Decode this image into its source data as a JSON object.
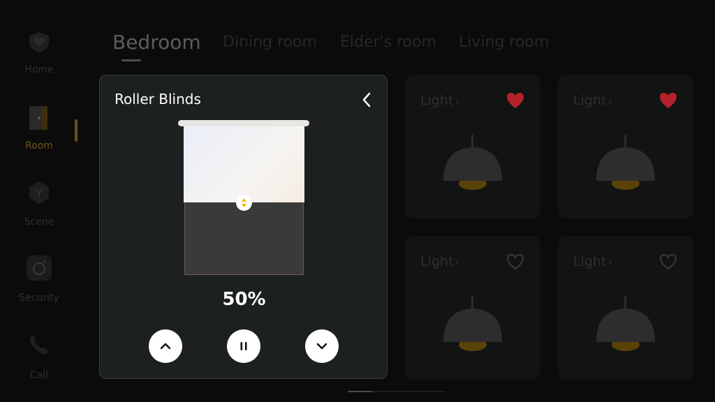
{
  "sidebar": {
    "items": [
      {
        "label": "Home",
        "icon": "heart-shield-icon"
      },
      {
        "label": "Room",
        "icon": "door-icon",
        "active": true
      },
      {
        "label": "Scene",
        "icon": "hexagon-icon"
      },
      {
        "label": "Security",
        "icon": "camera-icon"
      },
      {
        "label": "Call",
        "icon": "phone-icon"
      }
    ]
  },
  "tabs": [
    {
      "label": "Bedroom",
      "active": true
    },
    {
      "label": "Dining room"
    },
    {
      "label": "Elder's room"
    },
    {
      "label": "Living room"
    }
  ],
  "panel": {
    "title": "Roller Blinds",
    "position_percent": "50%",
    "position_fraction": 0.5
  },
  "cards": [
    {
      "title": "Light",
      "favorite": true
    },
    {
      "title": "Light",
      "favorite": true
    },
    {
      "title": "Light",
      "favorite": false
    },
    {
      "title": "Light",
      "favorite": false
    }
  ],
  "colors": {
    "accent": "#f5b400",
    "heart_active": "#b3222a",
    "panel_bg": "#1d2020"
  }
}
